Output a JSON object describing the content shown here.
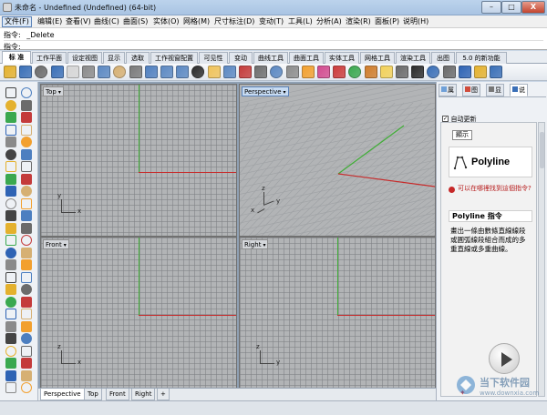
{
  "window": {
    "title": "未命名 - Undefined (Undefined) (64-bit)",
    "minimize": "–",
    "maximize": "□",
    "close": "X"
  },
  "menu": [
    "文件(F)",
    "编辑(E)",
    "查看(V)",
    "曲线(C)",
    "曲面(S)",
    "实体(O)",
    "网格(M)",
    "尺寸标注(D)",
    "变动(T)",
    "工具(L)",
    "分析(A)",
    "渲染(R)",
    "面板(P)",
    "说明(H)"
  ],
  "command": {
    "history_label": "指令:",
    "history_value": "_Delete",
    "prompt_label": "指令:",
    "prompt_value": ""
  },
  "toolbar_tabs": [
    "标 准",
    "工作平面",
    "设定视图",
    "显示",
    "选取",
    "工作视窗配置",
    "可见性",
    "变动",
    "曲线工具",
    "曲面工具",
    "实体工具",
    "网格工具",
    "渲染工具",
    "出图",
    "5.0 的新功能"
  ],
  "toolbar_icon_colors": [
    "#e4b12e",
    "#3a6fb7",
    "#6b6b6b",
    "#3a6fb7",
    "#d6d6d6",
    "#8a8a8a",
    "#5b88c2",
    "#d6b073",
    "#7a7a7a",
    "#4f7fbf",
    "#5b88c2",
    "#5b88c2",
    "#2c2c2c",
    "#f0c35a",
    "#5b88c2",
    "#c43b3b",
    "#6e6e6e",
    "#5b88c2",
    "#8c8c8c",
    "#f2a02f",
    "#d24b8f",
    "#cc3b3b",
    "#3aa84f",
    "#cf7c2b",
    "#f2d15a",
    "#6a6a6a",
    "#2b2b2b",
    "#3a6fb7",
    "#6a6a6a",
    "#2e63b4",
    "#e4b12e",
    "#3a6fb7"
  ],
  "viewports": {
    "top": {
      "label": "Top",
      "x": "x",
      "y": "y"
    },
    "perspective": {
      "label": "Perspective",
      "x": "x",
      "y": "y",
      "z": "z"
    },
    "front": {
      "label": "Front",
      "x": "x",
      "z": "z"
    },
    "right": {
      "label": "Right",
      "y": "y",
      "z": "z"
    }
  },
  "bottom_tabs": [
    "Perspective",
    "Top",
    "Front",
    "Right",
    "+"
  ],
  "right_panel": {
    "tabs": [
      "属",
      "图",
      "显",
      "说"
    ],
    "auto_update": "自动更新",
    "auto_update_checked": true,
    "display_btn": "顯示",
    "command_name": "Polyline",
    "help_link": "可以在哪裡找到這個指令?",
    "help_title": "Polyline 指令",
    "help_text": "畫出一條由數條直線線段或圓弧線段組合而成的多重直線或多重曲線。"
  },
  "watermark": {
    "brand": "当下软件园",
    "url": "www.downxia.com"
  }
}
